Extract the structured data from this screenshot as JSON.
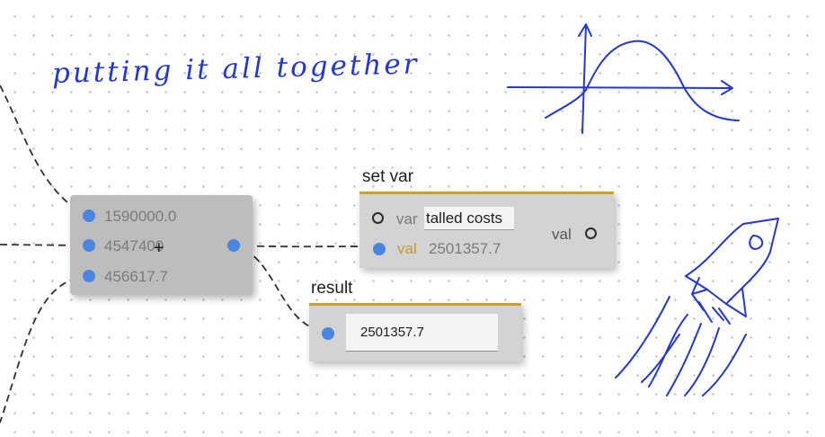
{
  "canvas": {
    "annotation": "putting it all together"
  },
  "sum_node": {
    "operator": "+",
    "inputs": [
      "1590000.0",
      "4547400",
      "456617.7"
    ]
  },
  "set_var_node": {
    "title": "set var",
    "var_label": "var",
    "var_value": "talled costs",
    "val_input_label": "val",
    "val_input_value": "2501357.7",
    "val_output_label": "val"
  },
  "result_node": {
    "title": "result",
    "value": "2501357.7"
  },
  "colors": {
    "port": "#4a86e0",
    "header_accent": "#c9a12d",
    "ink": "#2436d6",
    "node_bg": "#d3d3d3"
  },
  "icons": {
    "ports": "blue-dot",
    "var_port": "hollow-circle",
    "sketches": [
      "sine-wave-sketch",
      "rocket-sketch"
    ]
  }
}
